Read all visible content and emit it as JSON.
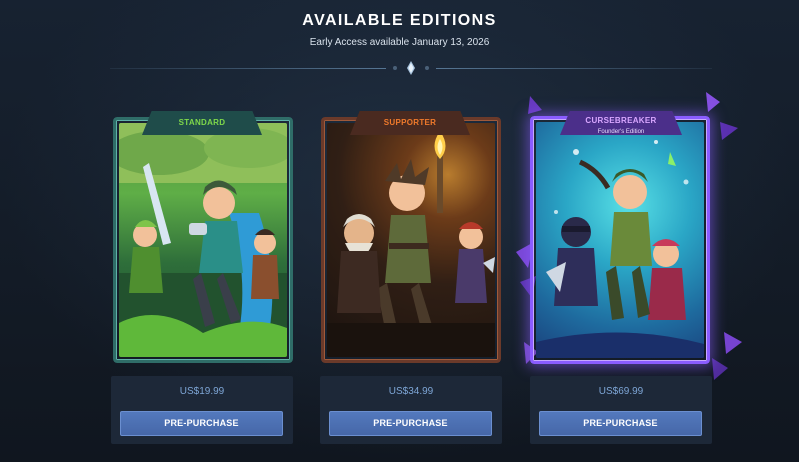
{
  "header": {
    "title": "AVAILABLE EDITIONS",
    "subtitle": "Early Access available January 13, 2026"
  },
  "editions": [
    {
      "name": "STANDARD",
      "price": "US$19.99",
      "button_label": "PRE-PURCHASE",
      "accent": "#7fd94a",
      "frame_color": "#2f6d68"
    },
    {
      "name": "SUPPORTER",
      "price": "US$34.99",
      "button_label": "PRE-PURCHASE",
      "accent": "#f07a2b",
      "frame_color": "#6b3a2a"
    },
    {
      "name": "CURSEBREAKER",
      "subtitle": "Founder's Edition",
      "price": "US$69.99",
      "button_label": "PRE-PURCHASE",
      "accent": "#d8a6ff",
      "frame_color": "#8a5cff"
    }
  ],
  "icons": {
    "divider": "diamond-icon"
  }
}
